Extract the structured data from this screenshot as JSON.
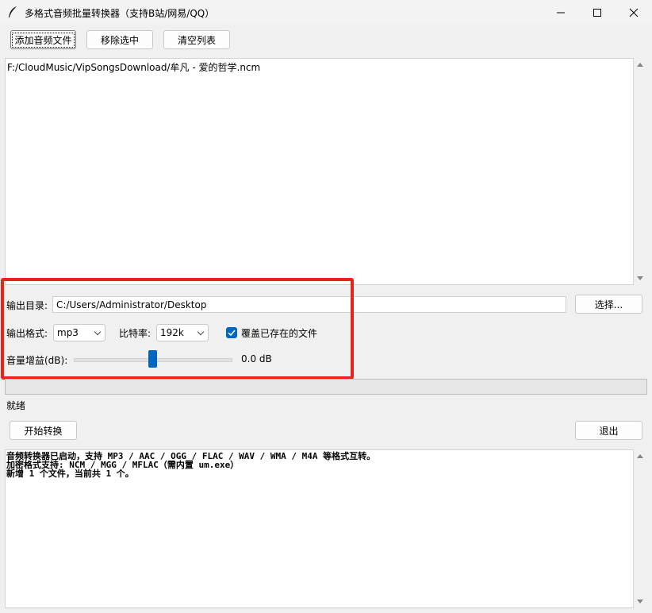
{
  "window": {
    "title": "多格式音频批量转换器（支持B站/网易/QQ）",
    "icon": "feather-icon",
    "controls": [
      "minimize-icon",
      "maximize-icon",
      "close-icon"
    ]
  },
  "toolbar": {
    "add_label": "添加音频文件",
    "remove_label": "移除选中",
    "clear_label": "清空列表"
  },
  "file_list": {
    "items": [
      "F:/CloudMusic/VipSongsDownload/牟凡 - 爱的哲学.ncm"
    ]
  },
  "output_dir": {
    "label": "输出目录:",
    "value": "C:/Users/Administrator/Desktop",
    "browse_label": "选择..."
  },
  "format": {
    "label": "输出格式:",
    "value": "mp3"
  },
  "bitrate": {
    "label": "比特率:",
    "value": "192k"
  },
  "overwrite": {
    "label": "覆盖已存在的文件",
    "checked": true
  },
  "gain": {
    "label": "音量增益(dB):",
    "value_text": "0.0 dB",
    "level": 0.5
  },
  "progress": {
    "value": 0
  },
  "status": {
    "text": "就绪"
  },
  "actions": {
    "start_label": "开始转换",
    "exit_label": "退出"
  },
  "log": {
    "lines": [
      "音频转换器已启动，支持 MP3 / AAC / OGG / FLAC / WAV / WMA / M4A 等格式互转。",
      "加密格式支持: NCM / MGG / MFLAC（需内置 um.exe）",
      "新增 1 个文件，当前共 1 个。"
    ]
  },
  "colors": {
    "accent": "#0067c0",
    "highlight_box": "#e8231d",
    "background": "#f0f0f0"
  }
}
